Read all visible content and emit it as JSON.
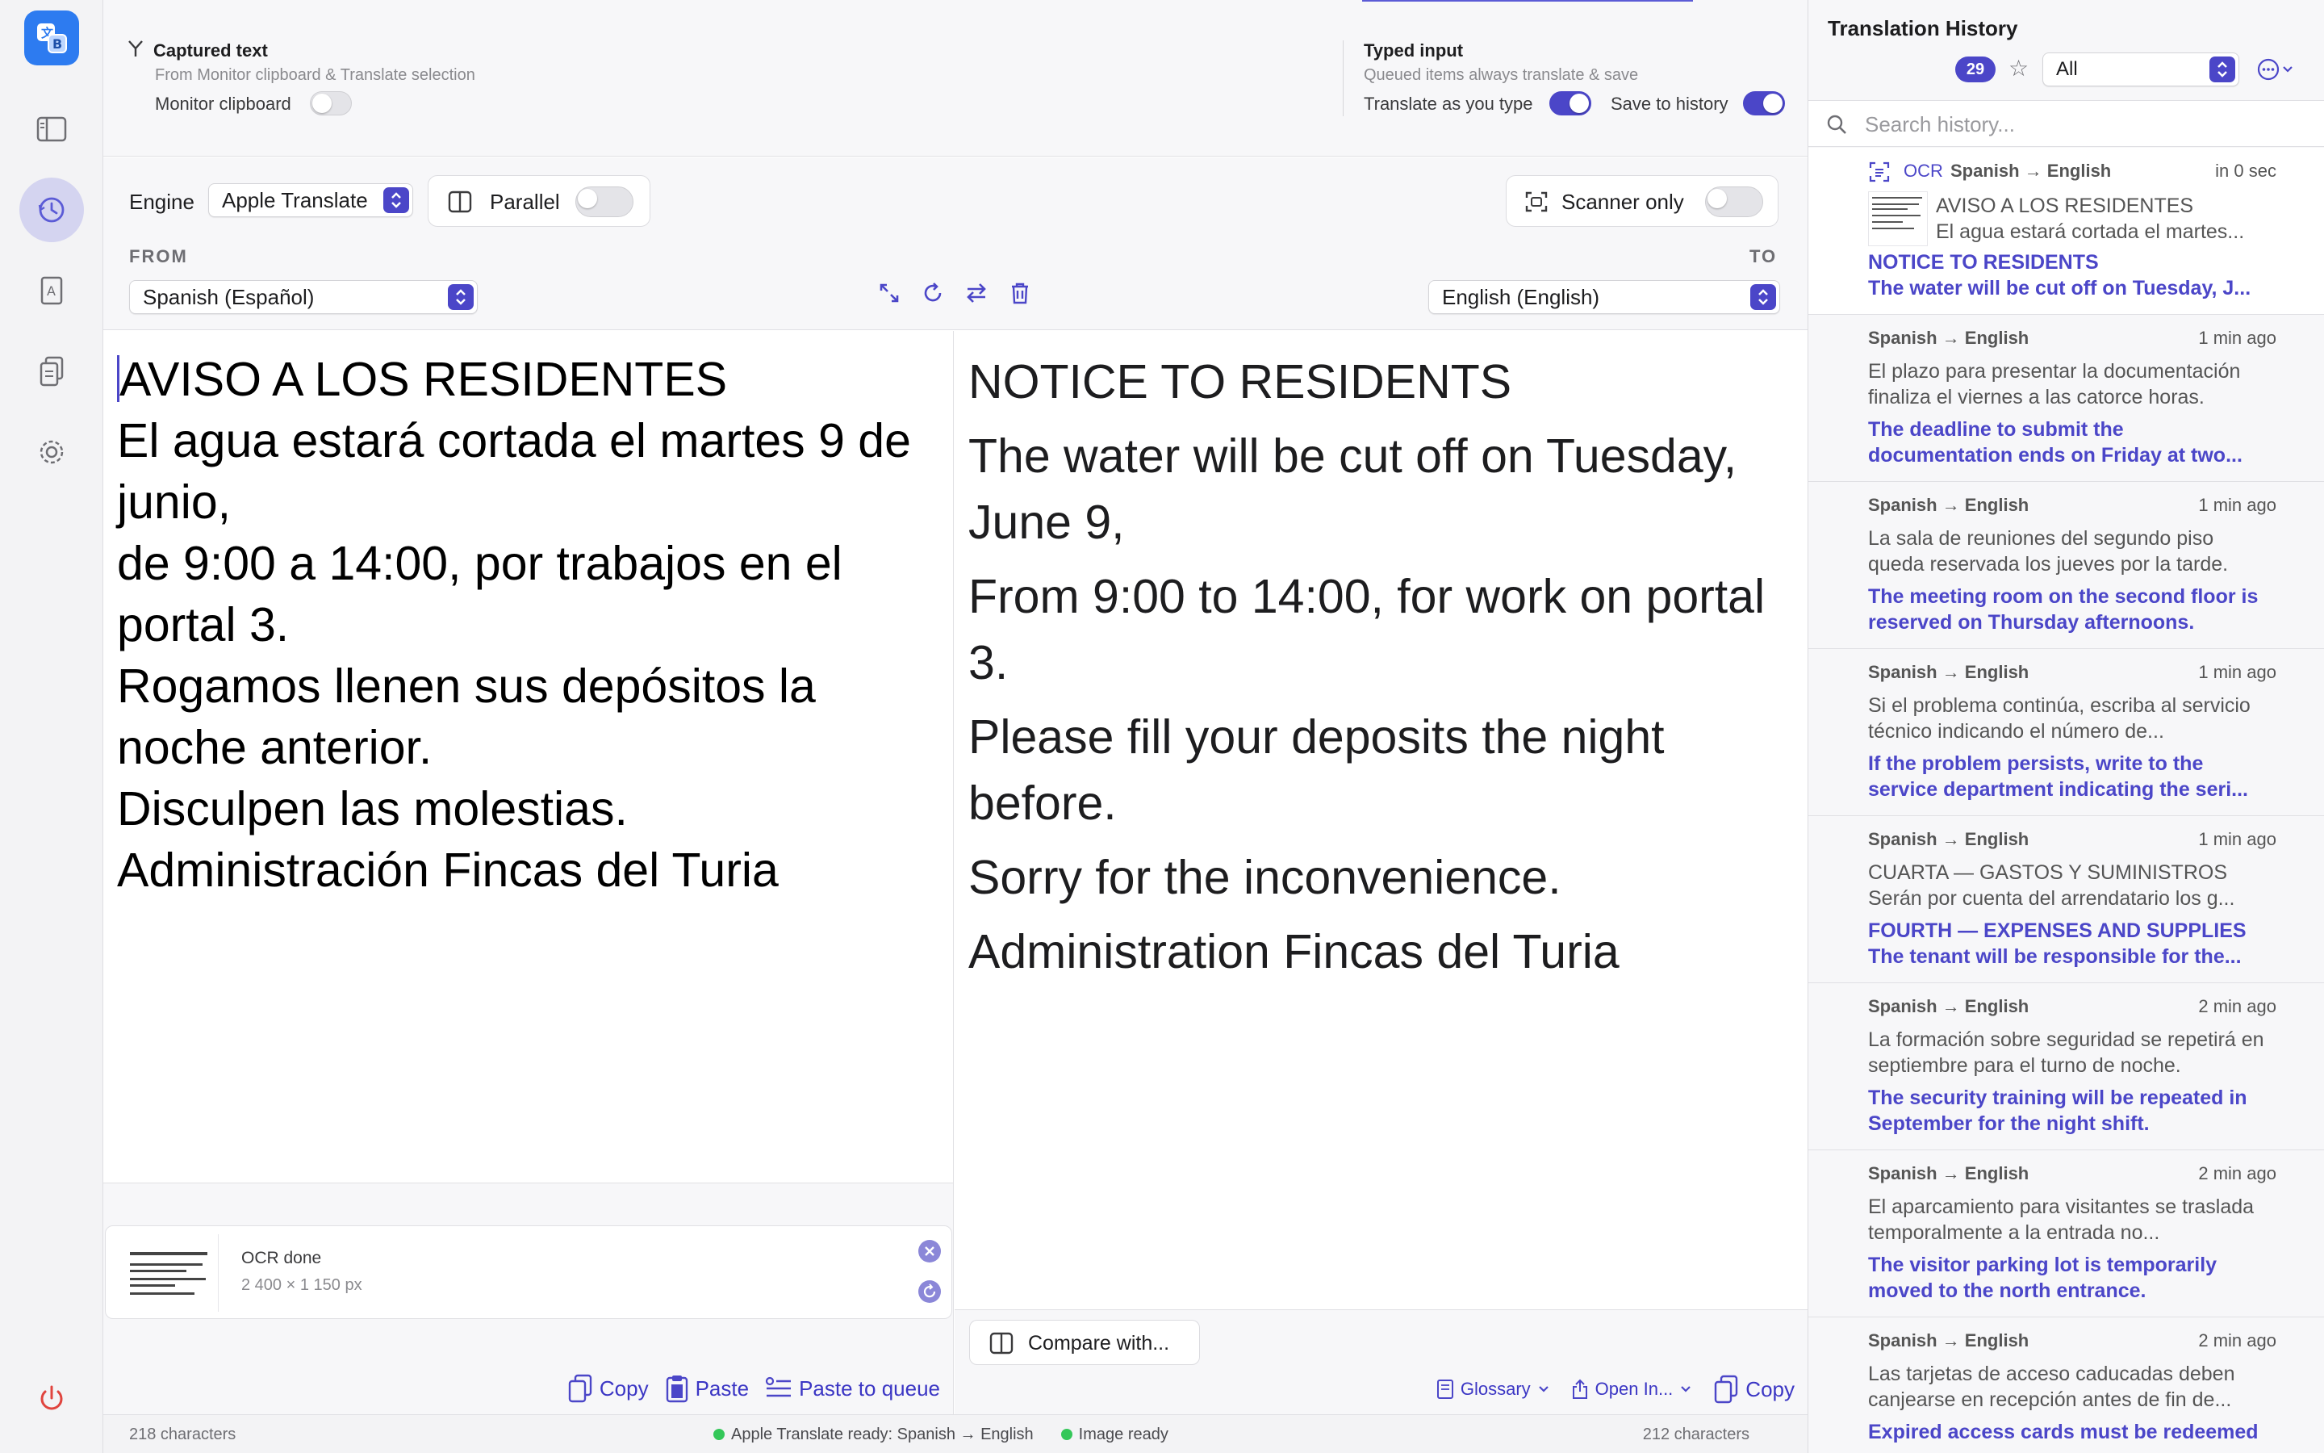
{
  "captured": {
    "title": "Captured text",
    "subtitle": "From Monitor clipboard & Translate selection",
    "monitor_label": "Monitor clipboard",
    "monitor_on": false
  },
  "typed": {
    "title": "Typed input",
    "subtitle": "Queued items always translate & save",
    "translate_as_you_type_label": "Translate as you type",
    "translate_as_you_type_on": true,
    "save_to_history_label": "Save to history",
    "save_to_history_on": true
  },
  "toolbar": {
    "engine_label": "Engine",
    "engine_value": "Apple Translate",
    "parallel_label": "Parallel",
    "parallel_on": false,
    "scanner_label": "Scanner only",
    "scanner_on": false,
    "from_label": "FROM",
    "to_label": "TO",
    "from_value": "Spanish (Español)",
    "to_value": "English (English)"
  },
  "source": {
    "lines": [
      "AVISO A LOS RESIDENTES",
      "El agua estará cortada el martes 9 de junio,",
      "de 9:00 a 14:00, por trabajos en el portal 3.",
      "Rogamos llenen sus depósitos la noche anterior.",
      "Disculpen las molestias.",
      "Administración Fincas del Turia"
    ]
  },
  "target": {
    "lines": [
      "NOTICE TO RESIDENTS",
      "The water will be cut off on Tuesday, June 9,",
      "From 9:00 to 14:00, for work on portal 3.",
      "Please fill your deposits the night before.",
      "Sorry for the inconvenience.",
      "Administration Fincas del Turia"
    ]
  },
  "ocr": {
    "status": "OCR done",
    "dims": "2 400 × 1 150 px"
  },
  "source_actions": {
    "copy": "Copy",
    "paste": "Paste",
    "paste_queue": "Paste to queue"
  },
  "target_actions": {
    "compare": "Compare with...",
    "glossary": "Glossary",
    "open_in": "Open In...",
    "copy": "Copy"
  },
  "status": {
    "source_chars": "218 characters",
    "engine_ready": "Apple Translate ready: Spanish → English",
    "image_ready": "Image ready",
    "target_chars": "212 characters",
    "ok_color": "#34c759"
  },
  "history": {
    "title": "Translation History",
    "count": "29",
    "filter": "All",
    "search_placeholder": "Search history...",
    "items": [
      {
        "tag": "OCR",
        "lang": "Spanish → English",
        "time": "in 0 sec",
        "src": "AVISO A LOS RESIDENTES",
        "src2": "El agua estará cortada el martes...",
        "tgt": "NOTICE TO RESIDENTS",
        "tgt2": "The water will be cut off on Tuesday, J..."
      },
      {
        "lang": "Spanish → English",
        "time": "1 min ago",
        "src": "El plazo para presentar la documentación finaliza el viernes a las catorce horas.",
        "tgt": "The deadline to submit the documentation ends on Friday at two..."
      },
      {
        "lang": "Spanish → English",
        "time": "1 min ago",
        "src": "La sala de reuniones del segundo piso queda reservada los jueves por la tarde.",
        "tgt": "The meeting room on the second floor is reserved on Thursday afternoons."
      },
      {
        "lang": "Spanish → English",
        "time": "1 min ago",
        "src": "Si el problema continúa, escriba al servicio técnico indicando el número de...",
        "tgt": "If the problem persists, write to the service department indicating the seri..."
      },
      {
        "lang": "Spanish → English",
        "time": "1 min ago",
        "src": "CUARTA — GASTOS Y SUMINISTROS",
        "src2": "Serán por cuenta del arrendatario los g...",
        "tgt": "FOURTH — EXPENSES AND SUPPLIES",
        "tgt2": "The tenant will be responsible for the..."
      },
      {
        "lang": "Spanish → English",
        "time": "2 min ago",
        "src": "La formación sobre seguridad se repetirá en septiembre para el turno de noche.",
        "tgt": "The security training will be repeated in September for the night shift."
      },
      {
        "lang": "Spanish → English",
        "time": "2 min ago",
        "src": "El aparcamiento para visitantes se traslada temporalmente a la entrada no...",
        "tgt": "The visitor parking lot is temporarily moved to the north entrance."
      },
      {
        "lang": "Spanish → English",
        "time": "2 min ago",
        "src": "Las tarjetas de acceso caducadas deben canjearse en recepción antes de fin de...",
        "tgt": "Expired access cards must be redeemed"
      }
    ]
  },
  "colors": {
    "accent": "#4b46c8",
    "app_icon": "#2d7bf0",
    "power": "#e0443e"
  }
}
